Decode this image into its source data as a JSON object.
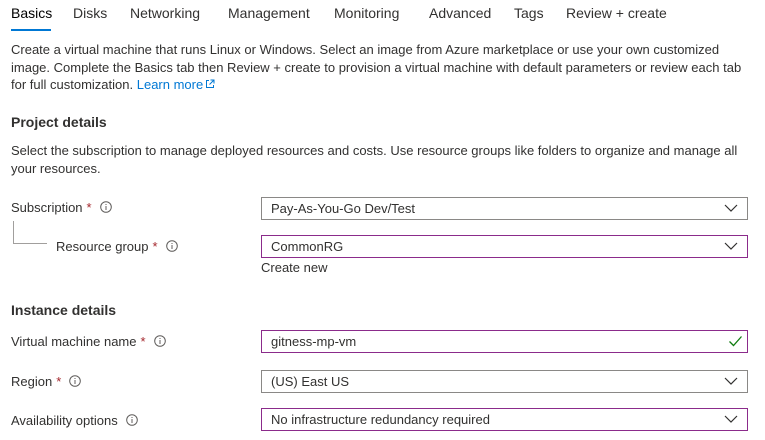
{
  "tabs": [
    {
      "label": "Basics",
      "active": true
    },
    {
      "label": "Disks"
    },
    {
      "label": "Networking"
    },
    {
      "label": "Management"
    },
    {
      "label": "Monitoring"
    },
    {
      "label": "Advanced"
    },
    {
      "label": "Tags"
    },
    {
      "label": "Review + create"
    }
  ],
  "intro": {
    "text": "Create a virtual machine that runs Linux or Windows. Select an image from Azure marketplace or use your own customized image. Complete the Basics tab then Review + create to provision a virtual machine with default parameters or review each tab for full customization.",
    "learn_more": "Learn more"
  },
  "project_details": {
    "title": "Project details",
    "description": "Select the subscription to manage deployed resources and costs. Use resource groups like folders to organize and manage all your resources.",
    "subscription": {
      "label": "Subscription",
      "required": "*",
      "value": "Pay-As-You-Go Dev/Test"
    },
    "resource_group": {
      "label": "Resource group",
      "required": "*",
      "value": "CommonRG",
      "create_new": "Create new"
    }
  },
  "instance_details": {
    "title": "Instance details",
    "vm_name": {
      "label": "Virtual machine name",
      "required": "*",
      "value": "gitness-mp-vm"
    },
    "region": {
      "label": "Region",
      "required": "*",
      "value": "(US) East US"
    },
    "availability": {
      "label": "Availability options",
      "value": "No infrastructure redundancy required"
    }
  },
  "colors": {
    "accent": "#0078d4",
    "required": "#a4262c",
    "focus_border": "#8b2b8b",
    "valid_check": "#107c10"
  }
}
